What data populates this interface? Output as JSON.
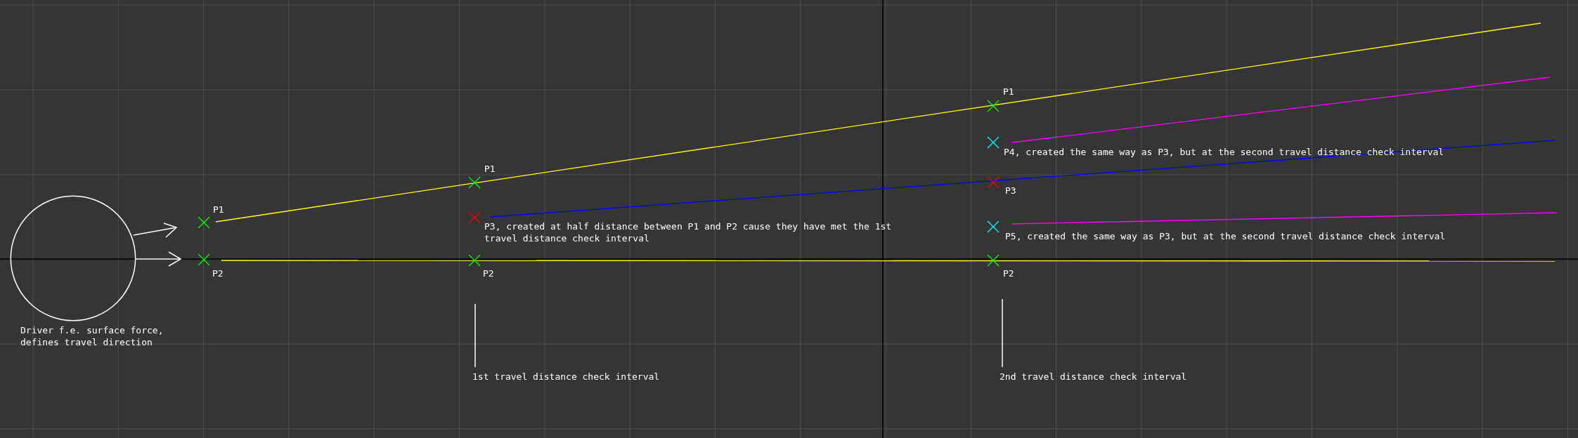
{
  "drawing": {
    "points": [
      {
        "label": "P1",
        "color": "#00ff00"
      },
      {
        "label": "P2",
        "color": "#00ff00"
      },
      {
        "label": "P1",
        "color": "#00ff00"
      },
      {
        "color": "#ff0000"
      },
      {
        "label": "P2",
        "color": "#00ff00"
      },
      {
        "label": "P1",
        "color": "#00ff00"
      },
      {
        "color": "#00ffff"
      },
      {
        "label": "P3",
        "color": "#ff0000"
      },
      {
        "color": "#00ffff"
      },
      {
        "label": "P2",
        "color": "#00ff00"
      }
    ],
    "lines": [
      {
        "color": "#ffff00"
      },
      {
        "color": "#ffff00"
      },
      {
        "color": "#0000ff"
      },
      {
        "color": "#ff00ff"
      },
      {
        "color": "#ff00ff"
      }
    ],
    "notes": [
      {
        "lines": [
          "Driver f.e. surface force,",
          "defines travel direction"
        ]
      },
      {
        "lines": [
          "P3, created at half distance between P1 and P2 cause they have met the 1st",
          "travel distance check interval"
        ]
      },
      {
        "lines": [
          "P4, created the same way as P3, but at the second travel distance check interval"
        ]
      },
      {
        "lines": [
          "P5, created the same way as P3, but at the second travel distance check interval"
        ]
      },
      {
        "lines": [
          "1st travel distance check interval"
        ]
      },
      {
        "lines": [
          "2nd travel distance check interval"
        ]
      }
    ]
  }
}
